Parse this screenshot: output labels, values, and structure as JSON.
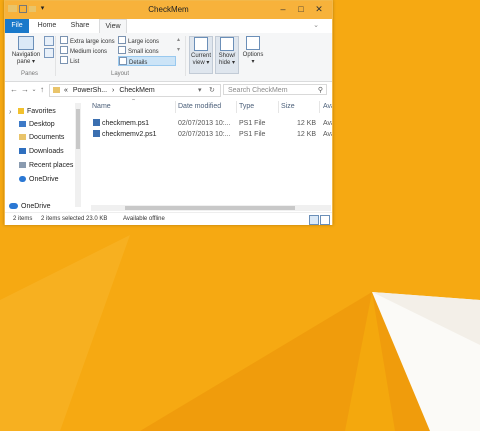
{
  "window": {
    "title": "CheckMem",
    "controls": [
      "–",
      "□",
      "✕"
    ]
  },
  "ribbon": {
    "tabs": [
      "File",
      "Home",
      "Share",
      "View"
    ],
    "nav_pane": {
      "label": "Navigation",
      "label2": "pane ▾",
      "group": "Panes"
    },
    "layout": {
      "items": [
        "Extra large icons",
        "Large icons",
        "Medium icons",
        "Small icons",
        "List",
        "Details"
      ],
      "group": "Layout"
    },
    "current_view": {
      "label": "Current",
      "label2": "view ▾"
    },
    "show_hide": {
      "label": "Show/",
      "label2": "hide ▾"
    },
    "options": {
      "label": "Options",
      "label2": "▾"
    }
  },
  "address": {
    "back": "←",
    "forward": "→",
    "recent": "⌄",
    "up": "↑",
    "path": [
      "«",
      "PowerSh...",
      "›",
      "CheckMem"
    ],
    "dropdown": "▾",
    "refresh": "↻",
    "search_placeholder": "Search CheckMem",
    "search_icon": "⚲"
  },
  "navigation_tree": {
    "items": [
      "Favorites",
      "Desktop",
      "Documents",
      "Downloads",
      "Recent places",
      "OneDrive",
      "OneDrive"
    ]
  },
  "file_list": {
    "columns": [
      "Name",
      "Date modified",
      "Type",
      "Size",
      "Ava"
    ],
    "rows": [
      {
        "name": "checkmem.ps1",
        "date": "02/07/2013 10:...",
        "type": "PS1 File",
        "size": "12 KB",
        "avail": "Ava"
      },
      {
        "name": "checkmemv2.ps1",
        "date": "02/07/2013 10:...",
        "type": "PS1 File",
        "size": "12 KB",
        "avail": "Ava"
      }
    ]
  },
  "status": {
    "items": "2 items",
    "selected": "2 items selected 23.0 KB",
    "offline": "Available offline"
  },
  "colors": {
    "desktop": "#f6a912",
    "title_bar": "#f7b23b",
    "file_tab": "#1979ca"
  }
}
